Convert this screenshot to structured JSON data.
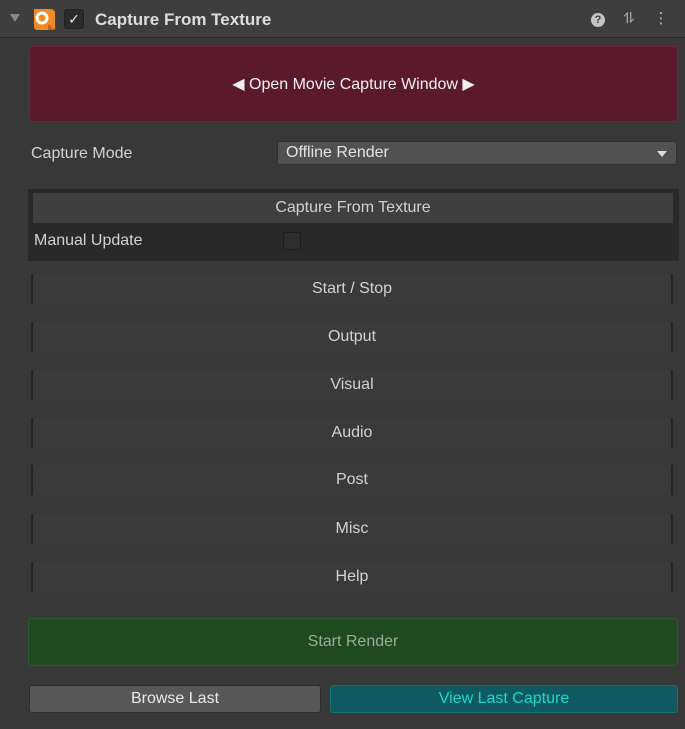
{
  "header": {
    "title": "Capture From Texture",
    "enabled_mark": "✓",
    "foldout_icon": "triangle-down-icon",
    "component_icon": "recorder-component-icon",
    "help_icon_glyph": "?",
    "preset_icon_glyph": "⥮",
    "menu_icon_glyph": "⋮"
  },
  "open_window": {
    "label": "◀ Open Movie Capture Window ▶",
    "color": "#5a1a2b"
  },
  "capture_mode": {
    "label": "Capture Mode",
    "selected": "Offline Render"
  },
  "texture_section": {
    "header": "Capture From Texture",
    "manual_update_label": "Manual Update",
    "manual_update_checked": false
  },
  "sections": [
    {
      "label": "Start / Stop"
    },
    {
      "label": "Output"
    },
    {
      "label": "Visual"
    },
    {
      "label": "Audio"
    },
    {
      "label": "Post"
    },
    {
      "label": "Misc"
    },
    {
      "label": "Help"
    }
  ],
  "actions": {
    "start_render": "Start Render",
    "browse_last": "Browse Last",
    "view_last_capture": "View Last Capture",
    "start_render_color": "#1f4a20",
    "view_last_color": "#0f5a60"
  }
}
